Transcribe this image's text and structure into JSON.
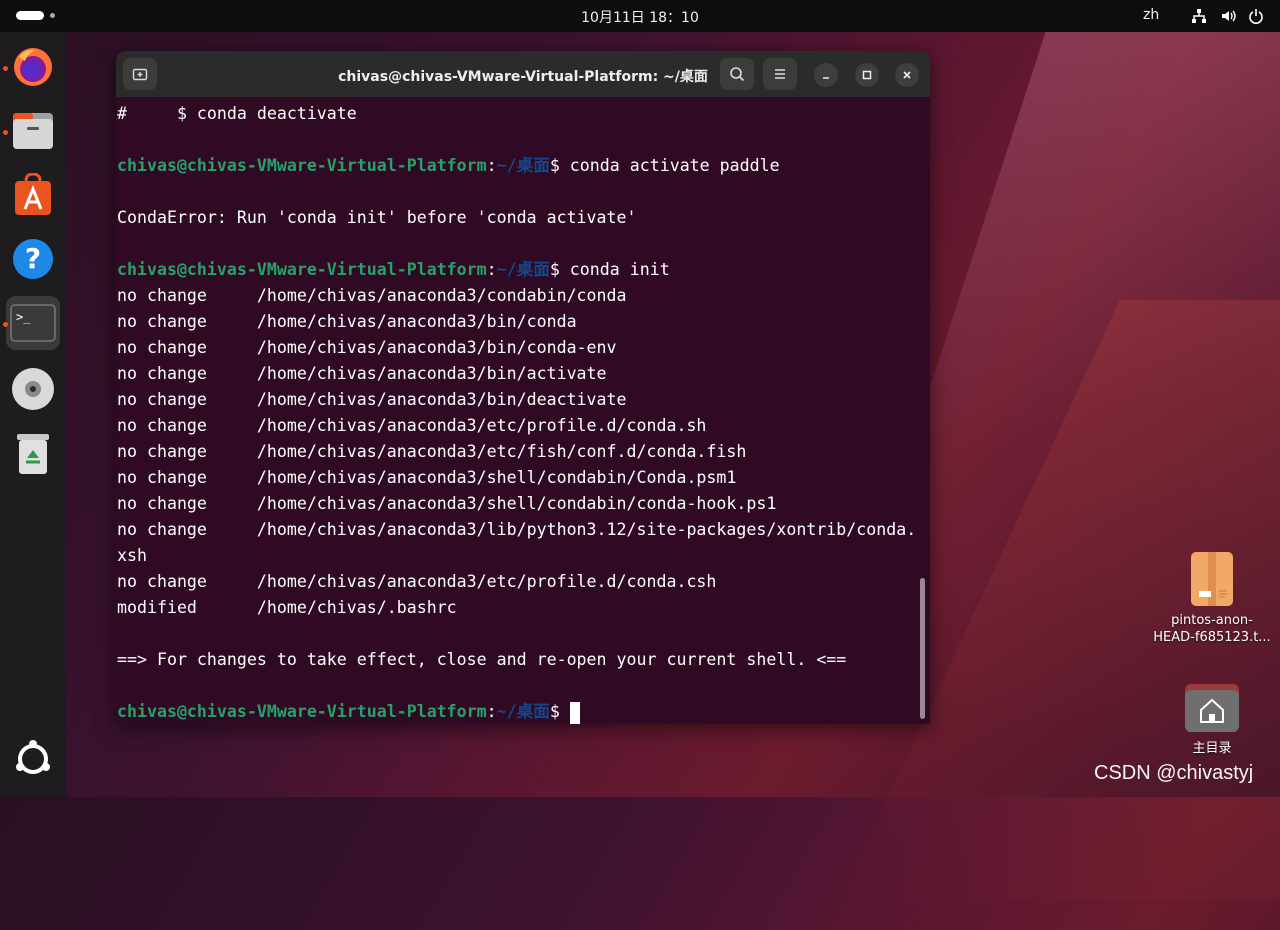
{
  "topbar": {
    "clock": "10月11日  18：10",
    "language": "zh",
    "tray_icons": [
      "network-icon",
      "volume-icon",
      "power-icon"
    ]
  },
  "dock": {
    "items": [
      {
        "name": "firefox",
        "running": true
      },
      {
        "name": "files",
        "running": true
      },
      {
        "name": "app-center",
        "running": false
      },
      {
        "name": "help",
        "running": false
      },
      {
        "name": "terminal",
        "running": true,
        "active": true
      },
      {
        "name": "dvd",
        "running": false
      },
      {
        "name": "trash",
        "running": false
      },
      {
        "name": "show-apps",
        "running": false
      }
    ]
  },
  "terminal": {
    "title": "chivas@chivas-VMware-Virtual-Platform: ~/桌面",
    "prompt_user": "chivas@chivas-VMware-Virtual-Platform",
    "prompt_colon": ":",
    "prompt_path": "~/桌面",
    "prompt_dollar": "$ ",
    "lines": [
      {
        "type": "text",
        "text": "#     $ conda deactivate"
      },
      {
        "type": "text",
        "text": ""
      },
      {
        "type": "prompt",
        "cmd": "conda activate paddle"
      },
      {
        "type": "text",
        "text": ""
      },
      {
        "type": "text",
        "text": "CondaError: Run 'conda init' before 'conda activate'"
      },
      {
        "type": "text",
        "text": ""
      },
      {
        "type": "prompt",
        "cmd": "conda init"
      },
      {
        "type": "text",
        "text": "no change     /home/chivas/anaconda3/condabin/conda"
      },
      {
        "type": "text",
        "text": "no change     /home/chivas/anaconda3/bin/conda"
      },
      {
        "type": "text",
        "text": "no change     /home/chivas/anaconda3/bin/conda-env"
      },
      {
        "type": "text",
        "text": "no change     /home/chivas/anaconda3/bin/activate"
      },
      {
        "type": "text",
        "text": "no change     /home/chivas/anaconda3/bin/deactivate"
      },
      {
        "type": "text",
        "text": "no change     /home/chivas/anaconda3/etc/profile.d/conda.sh"
      },
      {
        "type": "text",
        "text": "no change     /home/chivas/anaconda3/etc/fish/conf.d/conda.fish"
      },
      {
        "type": "text",
        "text": "no change     /home/chivas/anaconda3/shell/condabin/Conda.psm1"
      },
      {
        "type": "text",
        "text": "no change     /home/chivas/anaconda3/shell/condabin/conda-hook.ps1"
      },
      {
        "type": "text",
        "text": "no change     /home/chivas/anaconda3/lib/python3.12/site-packages/xontrib/conda."
      },
      {
        "type": "text",
        "text": "xsh"
      },
      {
        "type": "text",
        "text": "no change     /home/chivas/anaconda3/etc/profile.d/conda.csh"
      },
      {
        "type": "text",
        "text": "modified      /home/chivas/.bashrc"
      },
      {
        "type": "text",
        "text": ""
      },
      {
        "type": "text",
        "text": "==> For changes to take effect, close and re-open your current shell. <=="
      },
      {
        "type": "text",
        "text": ""
      },
      {
        "type": "prompt",
        "cmd": "",
        "cursor": true
      }
    ]
  },
  "desktop": {
    "file_icon_label_line1": "pintos-anon-",
    "file_icon_label_line2": "HEAD-f685123.t...",
    "home_icon_label": "主目录",
    "watermark": "CSDN @chivastyj"
  }
}
